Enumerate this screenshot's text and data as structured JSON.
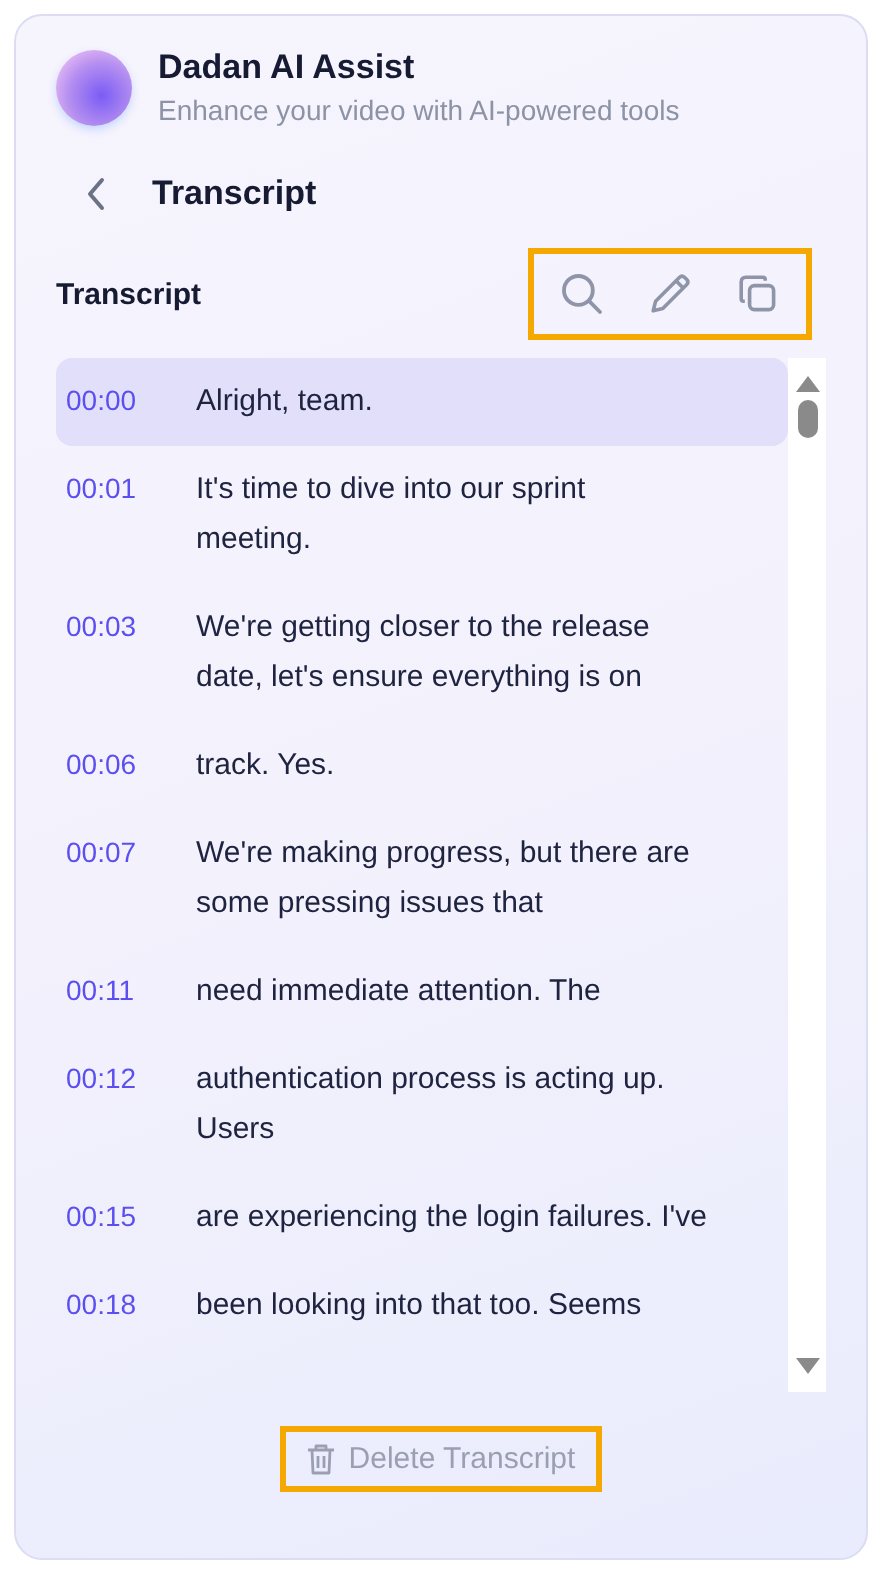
{
  "header": {
    "title": "Dadan AI Assist",
    "subtitle": "Enhance your video with AI-powered tools"
  },
  "nav": {
    "title": "Transcript"
  },
  "section": {
    "title": "Transcript",
    "toolbar_highlighted": true
  },
  "transcript": [
    {
      "time": "00:00",
      "lines": [
        "Alright, team."
      ],
      "selected": true
    },
    {
      "time": "00:01",
      "lines": [
        "It's time to dive into our sprint",
        "meeting."
      ],
      "selected": false
    },
    {
      "time": "00:03",
      "lines": [
        "We're getting closer to the release",
        "date, let's ensure everything is on"
      ],
      "selected": false
    },
    {
      "time": "00:06",
      "lines": [
        "track. Yes."
      ],
      "selected": false
    },
    {
      "time": "00:07",
      "lines": [
        "We're making progress, but there are",
        "some pressing issues that"
      ],
      "selected": false
    },
    {
      "time": "00:11",
      "lines": [
        "need immediate attention. The"
      ],
      "selected": false
    },
    {
      "time": "00:12",
      "lines": [
        "authentication process is acting up.",
        "Users"
      ],
      "selected": false
    },
    {
      "time": "00:15",
      "lines": [
        "are experiencing the login failures. I've"
      ],
      "selected": false
    },
    {
      "time": "00:18",
      "lines": [
        "been looking into that too. Seems"
      ],
      "selected": false
    }
  ],
  "delete_button": {
    "label": "Delete Transcript",
    "disabled": true,
    "highlighted": true
  }
}
